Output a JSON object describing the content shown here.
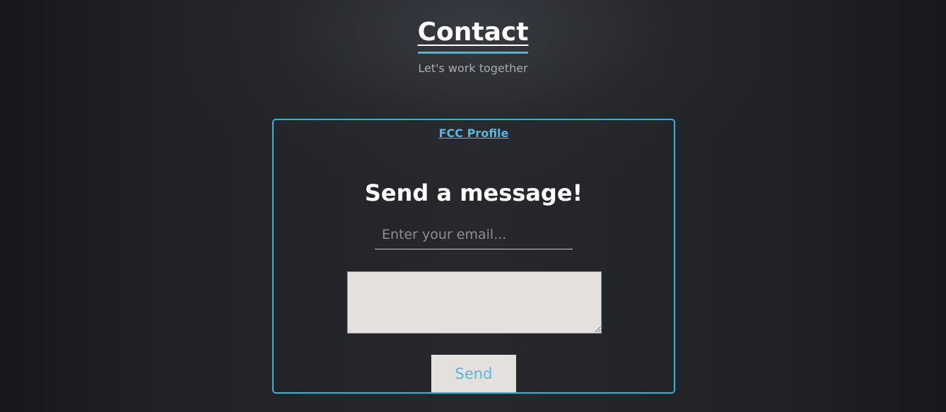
{
  "header": {
    "title": "Contact",
    "subtitle": "Let's work together"
  },
  "contact_box": {
    "profile_link": "FCC Profile",
    "heading": "Send a message!",
    "email_placeholder": "Enter your email...",
    "email_value": "",
    "message_value": "",
    "send_label": "Send"
  },
  "colors": {
    "accent": "#22bcd8",
    "link": "#5ab7de",
    "field_background": "#e3e0dd"
  }
}
